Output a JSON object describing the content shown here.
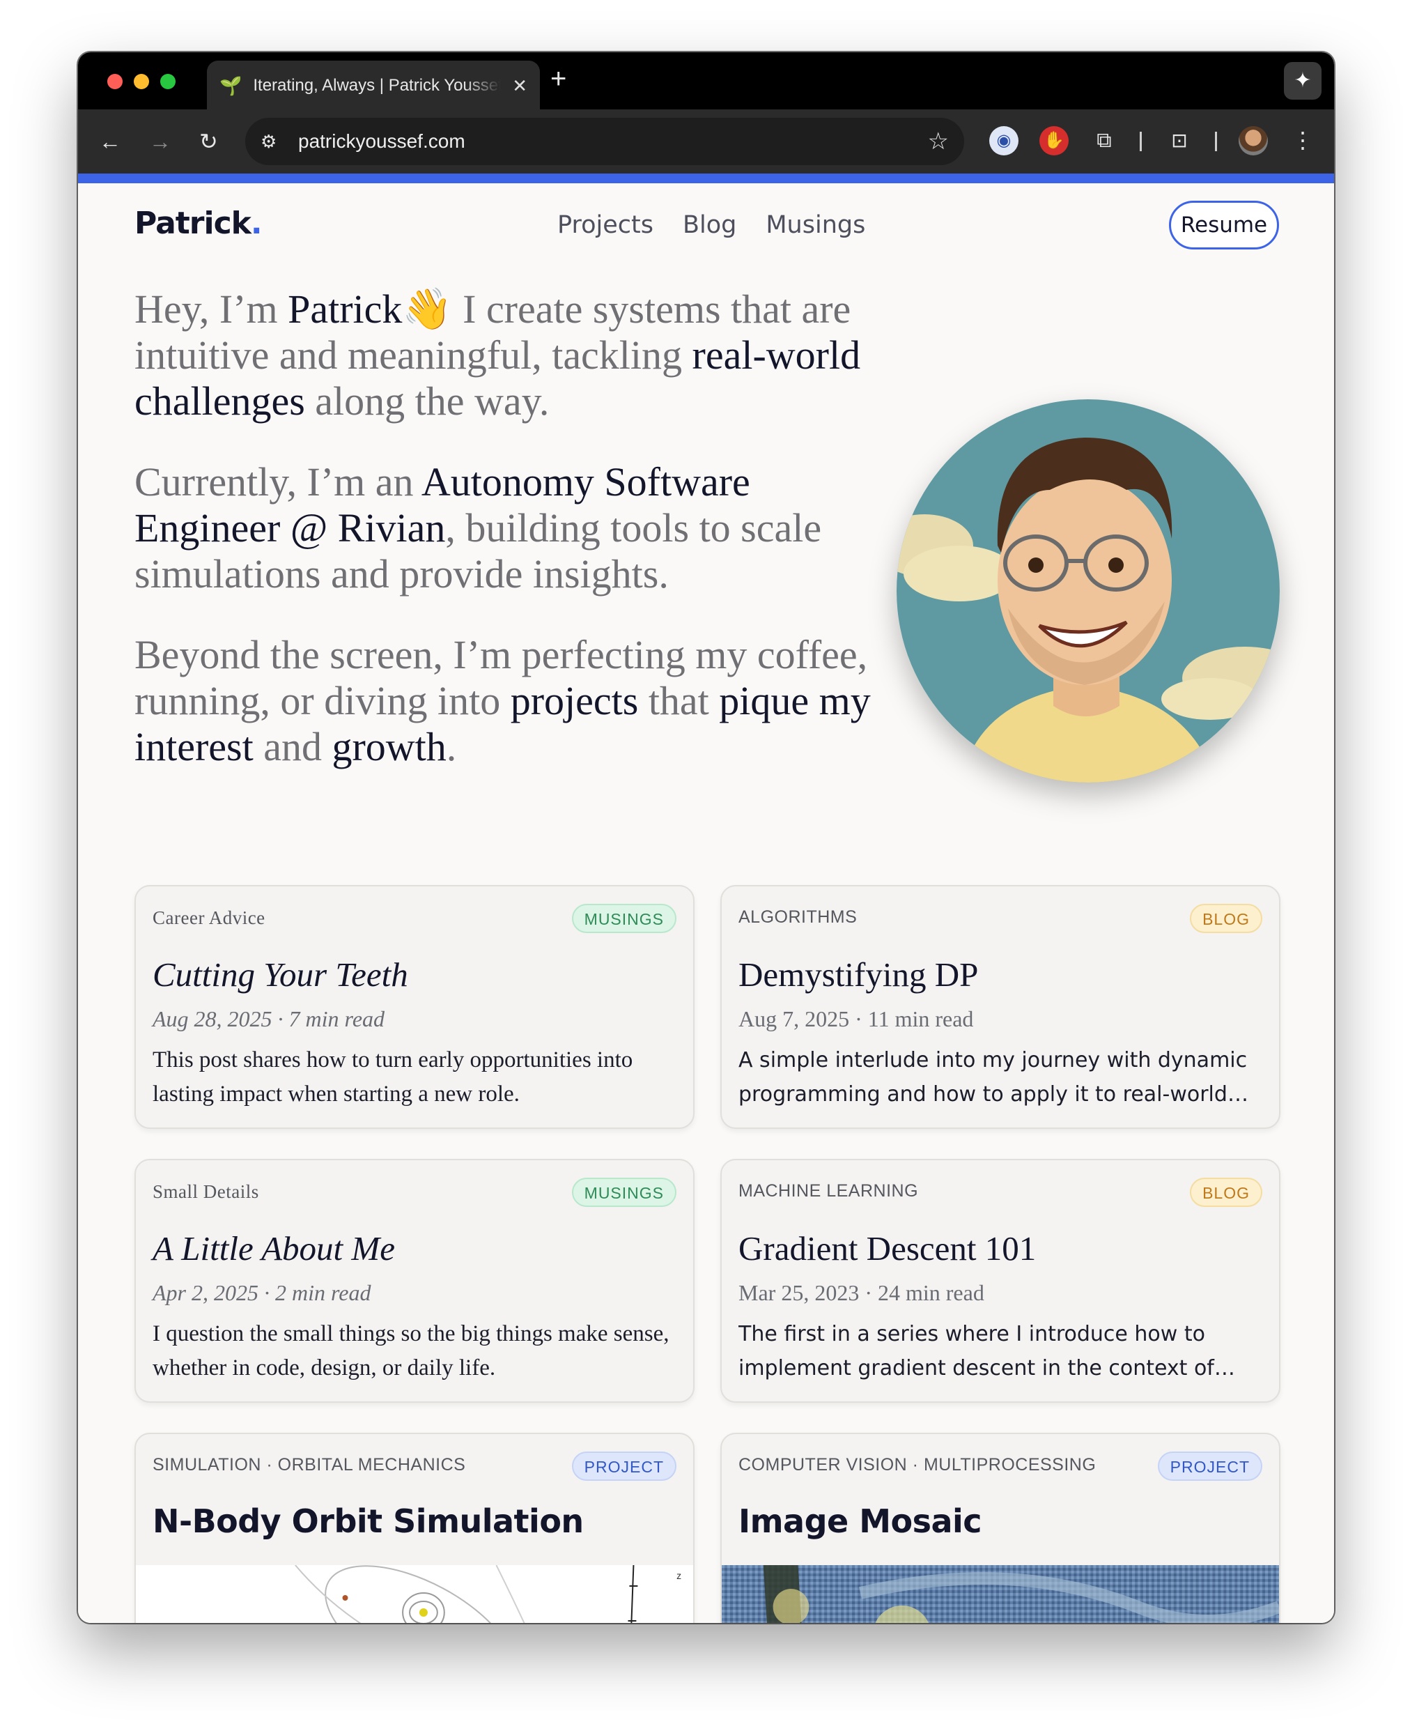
{
  "browser": {
    "tab_title": "Iterating, Always | Patrick Youssef",
    "url": "patrickyoussef.com",
    "colors": {
      "close": "#ff5f57",
      "minimize": "#febc2e",
      "zoom": "#28c840",
      "accent": "#3d64e6"
    }
  },
  "site": {
    "brand_name": "Patrick",
    "brand_dot": ".",
    "nav": [
      "Projects",
      "Blog",
      "Musings"
    ],
    "resume_label": "Resume"
  },
  "intro": {
    "p1": {
      "a": "Hey, I’m ",
      "name": "Patrick",
      "wave": "👋",
      "b": " I create systems that are intuitive and meaningful, tackling ",
      "em": "real-world challenges",
      "c": " along the way."
    },
    "p2": {
      "a": "Currently, I’m an ",
      "em": "Autonomy Software Engineer @ Rivian",
      "b": ", building tools to scale simulations and provide insights."
    },
    "p3": {
      "a": "Beyond the screen, I’m perfecting my coffee, running, or diving into ",
      "em1": "projects",
      "b": " that ",
      "em2": "pique my interest",
      "c": " and ",
      "em3": "growth",
      "d": "."
    }
  },
  "cards": [
    {
      "category": "Career Advice",
      "badge": "MUSINGS",
      "title": "Cutting Your Teeth",
      "meta": "Aug 28, 2025 · 7 min read",
      "desc": "This post shares how to turn early opportunities into lasting impact when starting a new role."
    },
    {
      "category": "ALGORITHMS",
      "badge": "BLOG",
      "title": "Demystifying DP",
      "meta": "Aug 7, 2025 · 11 min read",
      "desc": "A simple interlude into my journey with dynamic programming and how to apply it to real-world problems."
    },
    {
      "category": "Small Details",
      "badge": "MUSINGS",
      "title": "A Little About Me",
      "meta": "Apr 2, 2025 · 2 min read",
      "desc": "I question the small things so the big things make sense, whether in code, design, or daily life."
    },
    {
      "category": "MACHINE LEARNING",
      "badge": "BLOG",
      "title": "Gradient Descent 101",
      "meta": "Mar 25, 2023 · 24 min read",
      "desc": "The first in a series where I introduce how to implement gradient descent in the context of linear regression."
    },
    {
      "category": "SIMULATION · ORBITAL MECHANICS",
      "badge": "PROJECT",
      "title": "N-Body Orbit Simulation",
      "plot_axis_label": "z"
    },
    {
      "category": "COMPUTER VISION · MULTIPROCESSING",
      "badge": "PROJECT",
      "title": "Image Mosaic"
    }
  ]
}
